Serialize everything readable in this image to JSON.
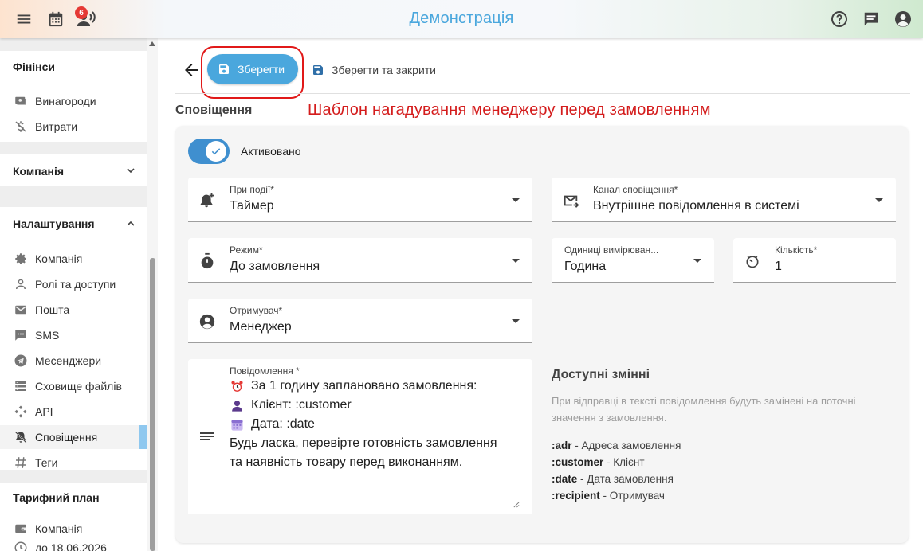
{
  "header": {
    "title": "Демонстрація",
    "notification_count": "6",
    "icons": [
      "menu-icon",
      "calendar-icon",
      "broadcast-user-icon",
      "help-icon",
      "chat-icon",
      "account-icon"
    ]
  },
  "sidebar": {
    "finance": {
      "title": "Фінінси",
      "items": [
        {
          "label": "Винагороди",
          "icon": "payments-icon"
        },
        {
          "label": "Витрати",
          "icon": "money-off-icon"
        }
      ]
    },
    "company": {
      "title": "Компанія"
    },
    "settings": {
      "title": "Налаштування",
      "items": [
        {
          "label": "Компанія",
          "icon": "gear-icon"
        },
        {
          "label": "Ролі та доступи",
          "icon": "person-icon"
        },
        {
          "label": "Пошта",
          "icon": "mail-icon"
        },
        {
          "label": "SMS",
          "icon": "sms-icon"
        },
        {
          "label": "Месенджери",
          "icon": "telegram-icon"
        },
        {
          "label": "Сховище файлів",
          "icon": "storage-icon"
        },
        {
          "label": "API",
          "icon": "api-icon"
        },
        {
          "label": "Сповіщення",
          "icon": "notifications-icon",
          "active": true
        },
        {
          "label": "Теги",
          "icon": "tag-icon"
        }
      ]
    },
    "plan": {
      "title": "Тарифний план",
      "items": [
        {
          "label": "Компанія",
          "icon": "wallet-icon"
        },
        {
          "label": "до 18.06.2026",
          "icon": "schedule-icon"
        }
      ]
    }
  },
  "toolbar": {
    "save_label": "Зберегти",
    "save_close_label": "Зберегти та закрити"
  },
  "page": {
    "section_title": "Сповіщення",
    "annotation": "Шаблон нагадування менеджеру перед замовленням"
  },
  "form": {
    "active_label": "Активовано",
    "active": true,
    "event": {
      "label": "При події*",
      "value": "Таймер"
    },
    "channel": {
      "label": "Канал сповіщення*",
      "value": "Внутрішне повідомлення в системі"
    },
    "mode": {
      "label": "Режим*",
      "value": "До замовлення"
    },
    "unit": {
      "label": "Одиниці вимірюван...",
      "value": "Година"
    },
    "quantity": {
      "label": "Кількість*",
      "value": "1"
    },
    "recipient": {
      "label": "Отримувач*",
      "value": "Менеджер"
    },
    "message": {
      "label": "Повідомлення *",
      "lines": [
        "За 1 годину заплановано замовлення:",
        "Клієнт: :customer",
        "Дата: :date",
        "Будь ласка, перевірте готовність замовлення",
        "та наявність товару перед виконанням."
      ]
    }
  },
  "variables": {
    "title": "Доступні змінні",
    "description": "При відправці в тексті повідомлення будуть замінені на поточні значення з замовлення.",
    "items": [
      {
        "key": ":adr",
        "desc": "- Адреса замовлення"
      },
      {
        "key": ":customer",
        "desc": "- Клієнт"
      },
      {
        "key": ":date",
        "desc": "- Дата замовлення"
      },
      {
        "key": ":recipient",
        "desc": "- Отримувач"
      }
    ]
  },
  "colors": {
    "accent": "#4aa7dd",
    "toggle": "#3f8fcf",
    "annotation": "#d41c1c",
    "badge": "#e53935"
  }
}
